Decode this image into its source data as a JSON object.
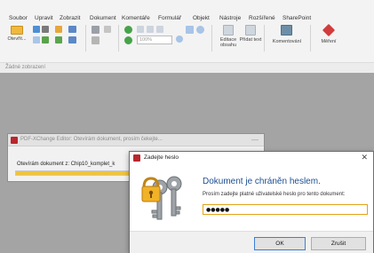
{
  "menu": {
    "items": [
      "Soubor",
      "Upravit",
      "Zobrazit",
      "Dokument",
      "Komentáře",
      "Formulář",
      "Objekt",
      "Nástroje",
      "Rozšířené",
      "SharePoint"
    ]
  },
  "toolbar": {
    "open_label": "Otevřít...",
    "zoom_value": "100%",
    "edit_text_label": "Editace obsahu",
    "add_text_label": "Přidat text",
    "comment_label": "Komentování",
    "measure_label": "Měření"
  },
  "view": {
    "label": "Žádné zobrazení"
  },
  "progress_window": {
    "title": "PDF-XChange Editor: Otevírám dokument, prosím čekejte...",
    "message": "Otevírám dokument z: Chip10_komplet_k",
    "progress": 0.55
  },
  "password_dialog": {
    "title": "Zadejte heslo",
    "heading": "Dokument je chráněn heslem.",
    "prompt": "Prosím zadejte platné uživatelské heslo pro tento dokument:",
    "password_value": "●●●●●",
    "ok_label": "OK",
    "cancel_label": "Zrušit"
  },
  "colors": {
    "accent_blue": "#1e4f91",
    "input_focus": "#e3a21a",
    "progress": "#f1c438",
    "app_red": "#b9272d"
  }
}
